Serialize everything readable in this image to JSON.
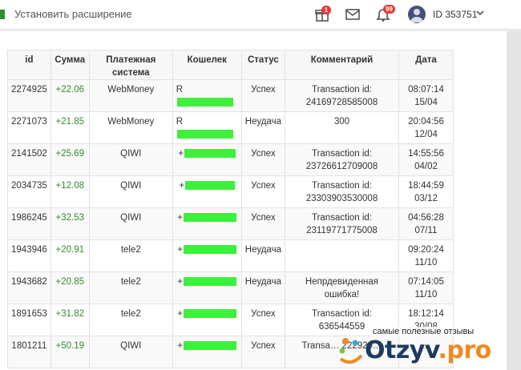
{
  "topbar": {
    "extension_label": "Установить расширение",
    "gift_badge": "1",
    "notify_badge": "99",
    "user_id": "ID 353751"
  },
  "table": {
    "headers": [
      "id",
      "Сумма",
      "Платежная система",
      "Кошелек",
      "Статус",
      "Комментарий",
      "Дата"
    ],
    "rows": [
      {
        "id": "2274925",
        "amount": "+22.06",
        "system": "WebMoney",
        "wallet_prefix": "R",
        "status": "Успех",
        "status_kind": "ok",
        "comment": "Transaction id: 24169728585008",
        "date": "08:07:14 15/04"
      },
      {
        "id": "2271073",
        "amount": "+21.85",
        "system": "WebMoney",
        "wallet_prefix": "R",
        "status": "Неудача",
        "status_kind": "fail",
        "comment": "300",
        "date": "20:04:56 12/04"
      },
      {
        "id": "2141502",
        "amount": "+25.69",
        "system": "QIWI",
        "wallet_prefix": "+",
        "status": "Успех",
        "status_kind": "ok",
        "comment": "Transaction id: 23726612709008",
        "date": "14:55:56 04/02"
      },
      {
        "id": "2034735",
        "amount": "+12.08",
        "system": "QIWI",
        "wallet_prefix": "+",
        "status": "Успех",
        "status_kind": "ok",
        "comment": "Transaction id: 23303903530008",
        "date": "18:44:59 03/12"
      },
      {
        "id": "1986245",
        "amount": "+32.53",
        "system": "QIWI",
        "wallet_prefix": "+",
        "status": "Успех",
        "status_kind": "ok",
        "comment": "Transaction id: 23119771775008",
        "date": "04:56:28 07/11"
      },
      {
        "id": "1943946",
        "amount": "+20.91",
        "system": "tele2",
        "wallet_prefix": "+",
        "status": "Неудача",
        "status_kind": "fail",
        "comment": "",
        "date": "09:20:24 11/10"
      },
      {
        "id": "1943682",
        "amount": "+20.85",
        "system": "tele2",
        "wallet_prefix": "+",
        "status": "Неудача",
        "status_kind": "fail",
        "comment": "Непрдевиденная ошибка!",
        "date": "07:14:05 11/10"
      },
      {
        "id": "1891653",
        "amount": "+31.82",
        "system": "tele2",
        "wallet_prefix": "+",
        "status": "Успех",
        "status_kind": "ok",
        "comment": "Transaction id: 636544559",
        "date": "18:12:14 30/08"
      },
      {
        "id": "1801211",
        "amount": "+50.19",
        "system": "QIWI",
        "wallet_prefix": "+",
        "status": "Успех",
        "status_kind": "ok",
        "comment": "Transa… 222920…",
        "date": "…"
      }
    ]
  },
  "watermark": {
    "caption": "самые полезные отзывы",
    "logo_main": "Otzyv",
    "logo_dot": ".",
    "logo_tld": "pro"
  },
  "colors": {
    "success": "#2e8b2e",
    "failure": "#e02020",
    "wallet_mask": "#3cf03c",
    "badge": "#e53935"
  },
  "icons": [
    "extension-icon",
    "gift-icon",
    "mail-icon",
    "bell-icon",
    "avatar",
    "chevron-down-icon"
  ]
}
